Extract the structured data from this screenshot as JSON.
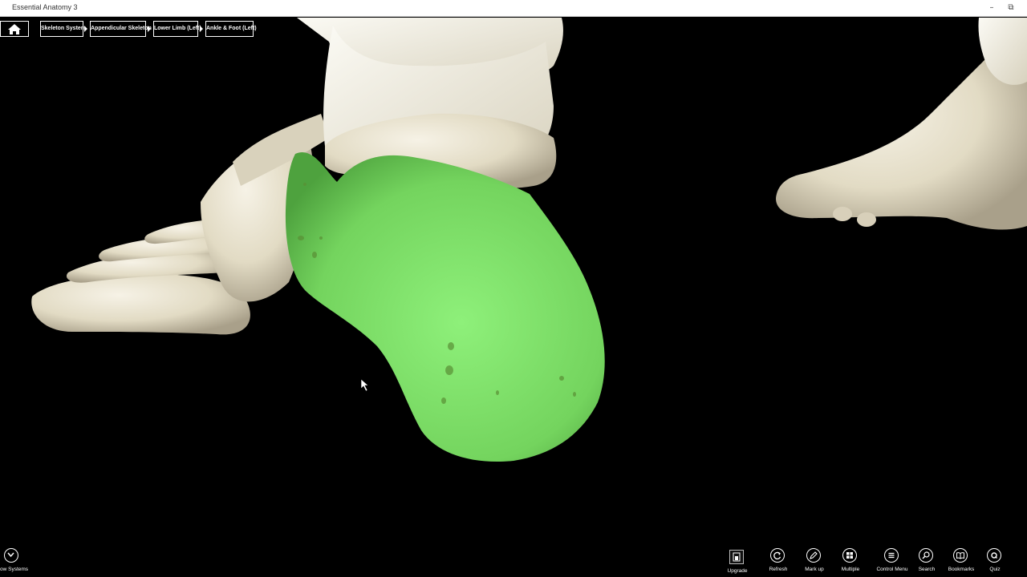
{
  "window": {
    "title": "Essential Anatomy 3",
    "minimize_icon": "minimize-icon",
    "restore_icon": "restore-icon"
  },
  "breadcrumb": {
    "home_icon": "home-icon",
    "items": [
      {
        "label": "Skeleton System"
      },
      {
        "label": "Appendicular Skeleton"
      },
      {
        "label": "Lower Limb (Left)"
      },
      {
        "label": "Ankle & Foot (Left)"
      }
    ]
  },
  "viewport": {
    "highlight_color": "#86e86a",
    "bone_color": "#e6e0cc"
  },
  "bottom_left": {
    "label": "ow Systems",
    "icon": "chevron-down-icon"
  },
  "toolbar": {
    "upgrade": "Upgrade",
    "refresh": "Refresh",
    "markup": "Mark up",
    "multiple": "Multiple",
    "control_menu": "Control Menu",
    "search": "Search",
    "bookmarks": "Bookmarks",
    "quiz": "Quiz"
  }
}
